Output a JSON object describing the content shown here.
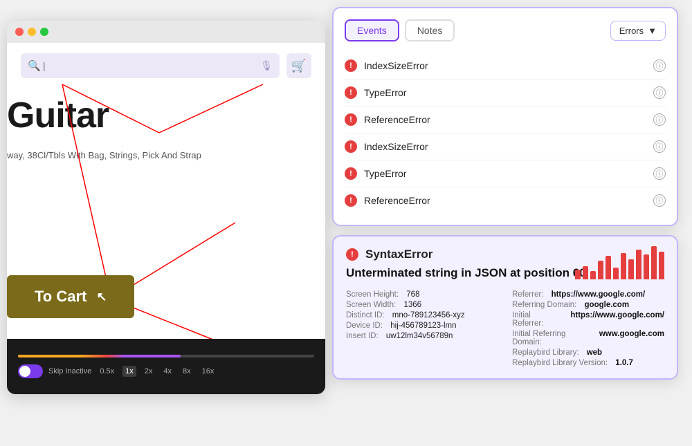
{
  "browser": {
    "dots": [
      "red",
      "yellow",
      "green"
    ]
  },
  "search": {
    "placeholder": "|",
    "value": ""
  },
  "product": {
    "title": "Guitar",
    "description": "way, 38Cl/Tbls With Bag, Strings, Pick And Strap",
    "add_to_cart": "To Cart"
  },
  "playback": {
    "skip_inactive": "Skip Inactive",
    "speeds": [
      "0.5x",
      "1x",
      "2x",
      "4x",
      "8x",
      "16x"
    ],
    "active_speed": "1x"
  },
  "events_panel": {
    "tabs": [
      {
        "label": "Events",
        "active": true
      },
      {
        "label": "Notes",
        "active": false
      }
    ],
    "filter_label": "Errors",
    "errors": [
      {
        "name": "IndexSizeError"
      },
      {
        "name": "TypeError"
      },
      {
        "name": "ReferenceError"
      },
      {
        "name": "IndexSizeError"
      },
      {
        "name": "TypeError"
      },
      {
        "name": "ReferenceError"
      }
    ]
  },
  "detail_panel": {
    "error_name": "SyntaxError",
    "message": "Unterminated string in JSON at position 60",
    "chart_bars": [
      15,
      20,
      12,
      28,
      35,
      18,
      40,
      30,
      45,
      38,
      50,
      42
    ],
    "meta_left": [
      {
        "label": "Screen Height:",
        "value": "768",
        "bold": false
      },
      {
        "label": "Screen Width:",
        "value": "1366",
        "bold": false
      },
      {
        "label": "Distinct ID:",
        "value": "mno-789123456-xyz",
        "bold": false
      },
      {
        "label": "Device ID:",
        "value": "hij-456789123-lmn",
        "bold": false
      },
      {
        "label": "Insert ID:",
        "value": "uw12lm34v56789n",
        "bold": false
      }
    ],
    "meta_right": [
      {
        "label": "Referrer:",
        "value": "https://www.google.com/",
        "bold": true
      },
      {
        "label": "Referring Domain:",
        "value": "google.com",
        "bold": true
      },
      {
        "label": "Initial Referrer:",
        "value": "https://www.google.com/",
        "bold": true
      },
      {
        "label": "Initial Referring Domain:",
        "value": "www.google.com",
        "bold": true
      },
      {
        "label": "Replaybird Library:",
        "value": "web",
        "bold": true
      },
      {
        "label": "Replaybird Library Version:",
        "value": "1.0.7",
        "bold": true
      }
    ]
  }
}
